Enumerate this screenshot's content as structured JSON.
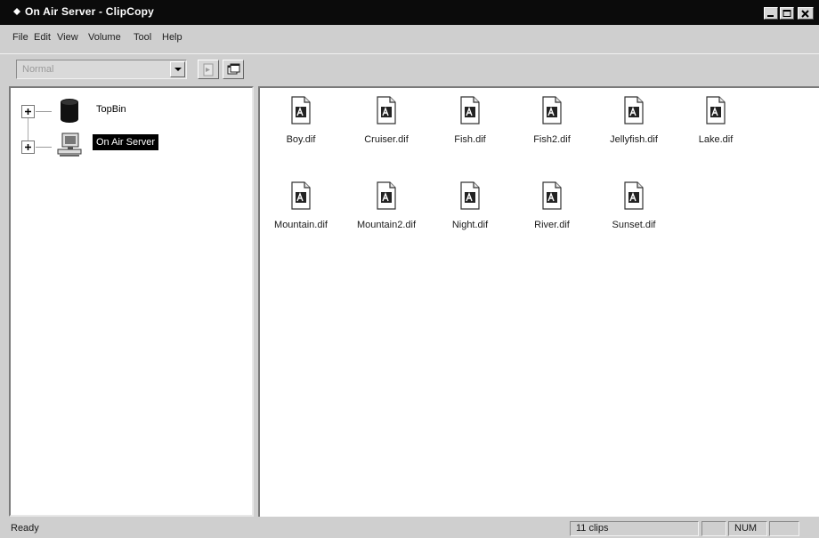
{
  "window": {
    "title": "On Air Server - ClipCopy"
  },
  "menu": {
    "file": "File",
    "edit": "Edit",
    "view": "View",
    "volume": "Volume",
    "tool": "Tool",
    "help": "Help"
  },
  "toolbar": {
    "mode_value": "Normal",
    "button1_icon": "arrow-doc-icon",
    "button2_icon": "copy-window-icon"
  },
  "tree": {
    "nodes": [
      {
        "label": "TopBin",
        "icon": "disk-cylinder-icon",
        "selected": false
      },
      {
        "label": "On Air Server",
        "icon": "server-computer-icon",
        "selected": true
      }
    ]
  },
  "files": [
    {
      "name": "Boy.dif"
    },
    {
      "name": "Cruiser.dif"
    },
    {
      "name": "Fish.dif"
    },
    {
      "name": "Fish2.dif"
    },
    {
      "name": "Jellyfish.dif"
    },
    {
      "name": "Lake.dif"
    },
    {
      "name": "Mountain.dif"
    },
    {
      "name": "Mountain2.dif"
    },
    {
      "name": "Night.dif"
    },
    {
      "name": "River.dif"
    },
    {
      "name": "Sunset.dif"
    }
  ],
  "status": {
    "text": "Ready",
    "clips": "11 clips",
    "num": "NUM"
  },
  "colors": {
    "titlebar": "#0b0b0b",
    "chrome": "#cfcfcf",
    "selection": "#000000"
  }
}
